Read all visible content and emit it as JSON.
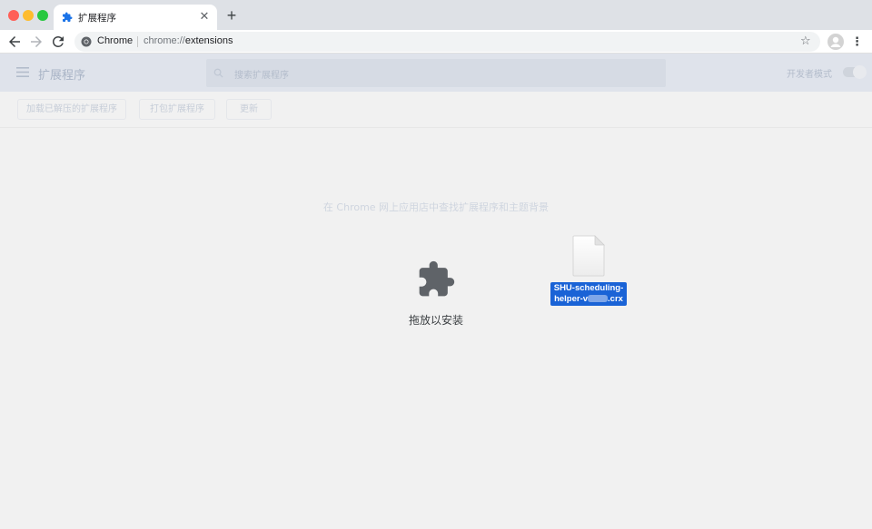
{
  "browser": {
    "tab": {
      "title": "扩展程序",
      "icon": "puzzle-icon"
    },
    "omnibox": {
      "chip_label": "Chrome",
      "url_scheme": "chrome://",
      "url_path": "extensions"
    }
  },
  "extensions_page": {
    "header_title": "扩展程序",
    "search_placeholder": "搜索扩展程序",
    "developer_mode_label": "开发者模式",
    "developer_mode_enabled": false,
    "actions": [
      {
        "label": "加载已解压的扩展程序"
      },
      {
        "label": "打包扩展程序"
      },
      {
        "label": "更新"
      }
    ],
    "store_link_text": "在 Chrome 网上应用店中查找扩展程序和主题背景"
  },
  "drop_zone": {
    "label": "拖放以安装",
    "icon": "puzzle-icon"
  },
  "dragged_file": {
    "name_line1": "SHU-scheduling-",
    "name_line2_prefix": "helper-v",
    "name_line2_suffix": ".crx",
    "icon": "document-icon"
  },
  "colors": {
    "selection_blue": "#1a63d6",
    "drop_icon": "#5f6368"
  }
}
